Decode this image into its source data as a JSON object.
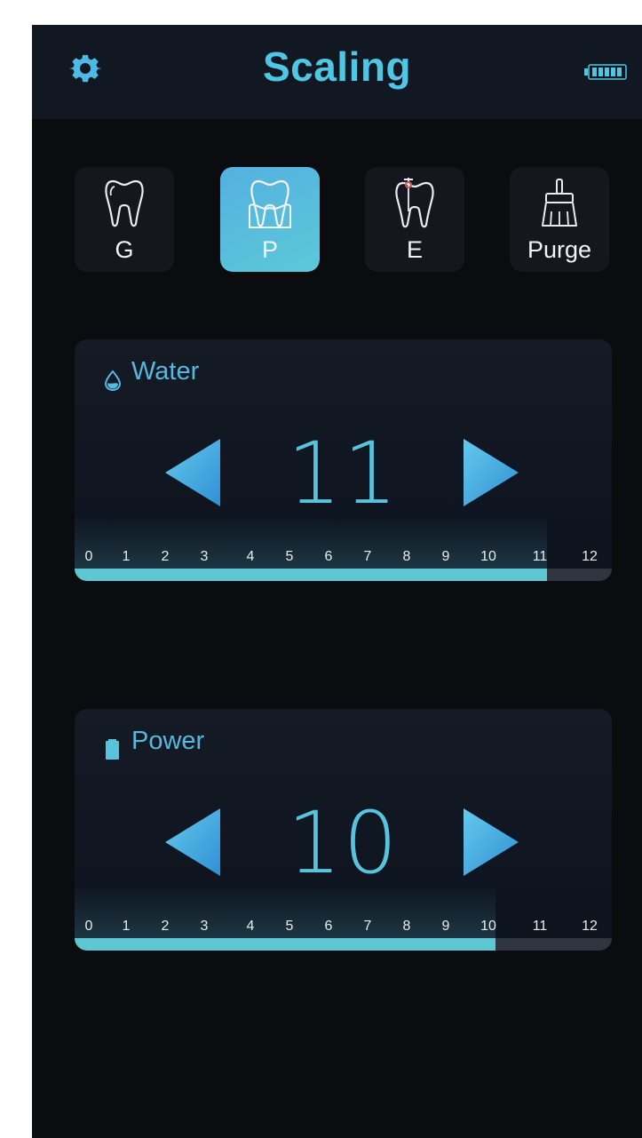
{
  "header": {
    "title": "Scaling",
    "icons": {
      "settings": "gear-icon",
      "battery": "battery-icon"
    }
  },
  "modes": [
    {
      "label": "G",
      "icon": "tooth-icon",
      "active": false
    },
    {
      "label": "P",
      "icon": "tooth-gum-icon",
      "active": true
    },
    {
      "label": "E",
      "icon": "tooth-root-file-icon",
      "active": false
    },
    {
      "label": "Purge",
      "icon": "brush-icon",
      "active": false
    }
  ],
  "water": {
    "label": "Water",
    "icon": "water-drop-icon",
    "value": "11",
    "level": 11,
    "scale_max": 12,
    "ticks": [
      "0",
      "1",
      "2",
      "3",
      "4",
      "5",
      "6",
      "7",
      "8",
      "9",
      "10",
      "11",
      "12"
    ]
  },
  "power": {
    "label": "Power",
    "icon": "battery-level-icon",
    "value": "10",
    "level": 10,
    "scale_max": 12,
    "ticks": [
      "0",
      "1",
      "2",
      "3",
      "4",
      "5",
      "6",
      "7",
      "8",
      "9",
      "10",
      "11",
      "12"
    ]
  },
  "colors": {
    "accent": "#4fc6e4",
    "active_mode": "#54b1e0",
    "fill": "#5cc6d3",
    "background": "#0a0c10"
  }
}
